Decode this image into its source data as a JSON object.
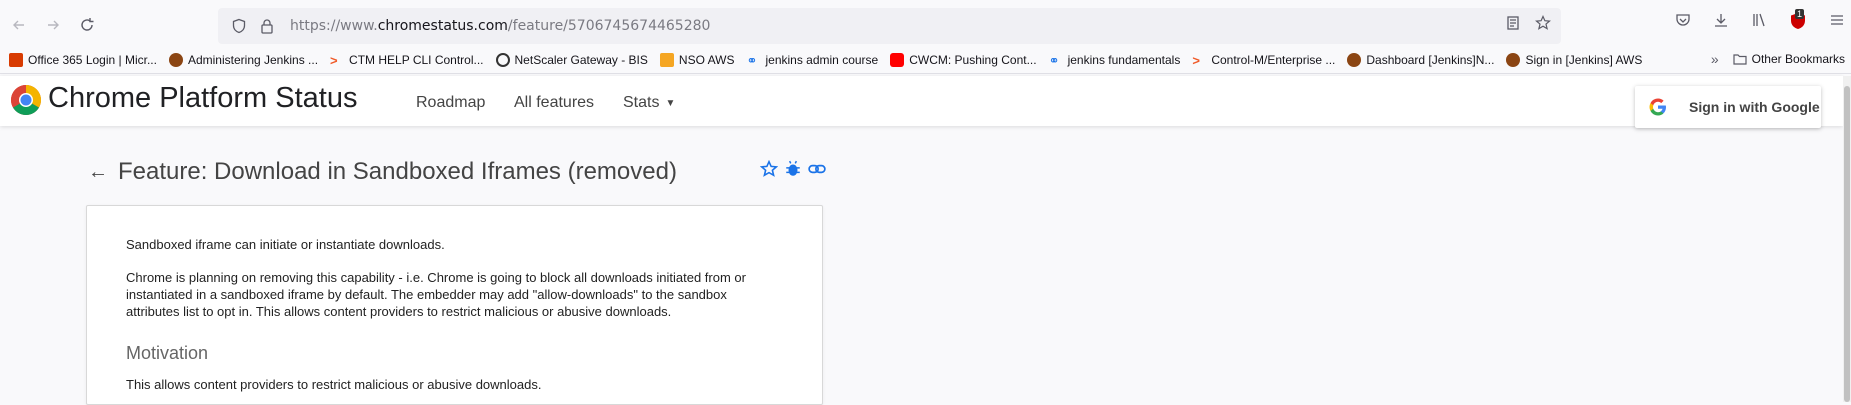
{
  "browser": {
    "url_prefix": "https://www.",
    "url_domain": "chromestatus.com",
    "url_path": "/feature/5706745674465280",
    "notification_count": "1"
  },
  "bookmarks": [
    {
      "label": "Office 365 Login | Micr...",
      "icon": "office-icon",
      "color": "#d83b01"
    },
    {
      "label": "Administering Jenkins ...",
      "icon": "jenkins-icon",
      "color": "#8b4513"
    },
    {
      "label": "CTM HELP CLI Control...",
      "icon": "control-m-icon",
      "color": "#f05a28"
    },
    {
      "label": "NetScaler Gateway - BIS",
      "icon": "netscaler-icon",
      "color": "#333333"
    },
    {
      "label": "NSO AWS",
      "icon": "aws-icon",
      "color": "#f5a623"
    },
    {
      "label": "jenkins admin course",
      "icon": "link-icon",
      "color": "#1a73e8"
    },
    {
      "label": "CWCM: Pushing Cont...",
      "icon": "youtube-icon",
      "color": "#ff0000"
    },
    {
      "label": "jenkins fundamentals",
      "icon": "link-icon",
      "color": "#1a73e8"
    },
    {
      "label": "Control-M/Enterprise ...",
      "icon": "control-m-icon",
      "color": "#f05a28"
    },
    {
      "label": "Dashboard [Jenkins]N...",
      "icon": "jenkins-icon",
      "color": "#8b4513"
    },
    {
      "label": "Sign in [Jenkins] AWS",
      "icon": "jenkins-icon",
      "color": "#8b4513"
    }
  ],
  "other_bookmarks": "Other Bookmarks",
  "site": {
    "title": "Chrome Platform Status",
    "nav": [
      "Roadmap",
      "All features",
      "Stats"
    ],
    "signin": "Sign in with Google"
  },
  "feature": {
    "title": "Feature: Download in Sandboxed Iframes (removed)",
    "summary": "Sandboxed iframe can initiate or instantiate downloads.",
    "description_line1": "Chrome is planning on removing this capability - i.e. Chrome is going to block all downloads initiated from or",
    "description_line2": "instantiated in a sandboxed iframe by default. The embedder may add \"allow-downloads\" to the sandbox",
    "description_line3": "attributes list to opt in. This allows content providers to restrict malicious or abusive downloads.",
    "motivation_heading": "Motivation",
    "motivation_text": "This allows content providers to restrict malicious or abusive downloads."
  },
  "colors": {
    "accent": "#1a73e8",
    "text": "#202124"
  }
}
